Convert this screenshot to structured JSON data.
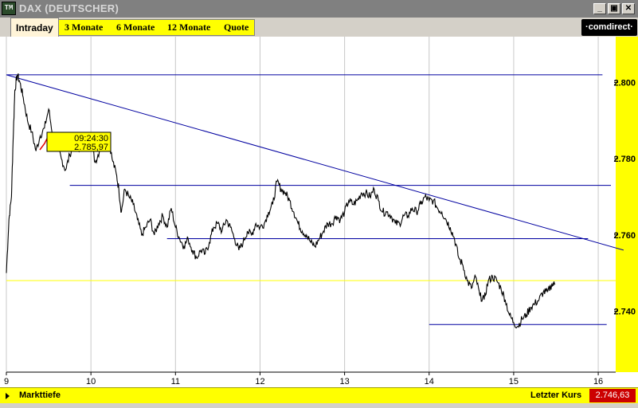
{
  "window": {
    "app_icon": "TM",
    "title": "DAX (DEUTSCHER)",
    "minimize_glyph": "_",
    "restore_glyph": "▣",
    "close_glyph": "✕"
  },
  "tabs": [
    {
      "label": "Intraday",
      "active": true
    },
    {
      "label": "3 Monate"
    },
    {
      "label": "6 Monate"
    },
    {
      "label": "12 Monate"
    },
    {
      "label": "Quote"
    }
  ],
  "brand": "·comdirect·",
  "tooltip": {
    "time": "09:24:30",
    "value": "2.785,97"
  },
  "bottom_bar": {
    "left_label": "Markttiefe",
    "last_price_label": "Letzter Kurs",
    "last_price": "2.746,63"
  },
  "colors": {
    "accent_yellow": "#ffff00",
    "trendline": "#0000a0",
    "price_line": "#000000",
    "last_price_bg": "#cc0000"
  },
  "chart_data": {
    "type": "line",
    "title": "",
    "xlabel": "",
    "ylabel": "",
    "x_ticks": [
      "9",
      "10",
      "11",
      "12",
      "13",
      "14",
      "15",
      "16"
    ],
    "y_ticks": [
      "2.800",
      "2.780",
      "2.760",
      "2.740"
    ],
    "xlim": [
      9.0,
      16.15
    ],
    "ylim": [
      2724,
      2812
    ],
    "grid": true,
    "series": [
      {
        "values": [
          [
            9.0,
            2750
          ],
          [
            9.03,
            2764
          ],
          [
            9.06,
            2770
          ],
          [
            9.08,
            2785
          ],
          [
            9.1,
            2798
          ],
          [
            9.13,
            2802
          ],
          [
            9.16,
            2800
          ],
          [
            9.2,
            2796
          ],
          [
            9.25,
            2790
          ],
          [
            9.3,
            2787
          ],
          [
            9.35,
            2782
          ],
          [
            9.4,
            2786
          ],
          [
            9.45,
            2788
          ],
          [
            9.5,
            2793
          ],
          [
            9.55,
            2786
          ],
          [
            9.6,
            2784
          ],
          [
            9.65,
            2780
          ],
          [
            9.7,
            2777
          ],
          [
            9.75,
            2781
          ],
          [
            9.8,
            2784
          ],
          [
            9.85,
            2782
          ],
          [
            9.9,
            2786
          ],
          [
            9.95,
            2783
          ],
          [
            10.0,
            2785
          ],
          [
            10.05,
            2779
          ],
          [
            10.1,
            2782
          ],
          [
            10.15,
            2784
          ],
          [
            10.2,
            2787
          ],
          [
            10.25,
            2780
          ],
          [
            10.3,
            2776
          ],
          [
            10.33,
            2772
          ],
          [
            10.36,
            2766
          ],
          [
            10.4,
            2772
          ],
          [
            10.45,
            2770
          ],
          [
            10.5,
            2768
          ],
          [
            10.55,
            2764
          ],
          [
            10.6,
            2760
          ],
          [
            10.65,
            2762
          ],
          [
            10.7,
            2764
          ],
          [
            10.75,
            2760
          ],
          [
            10.8,
            2763
          ],
          [
            10.85,
            2765
          ],
          [
            10.9,
            2762
          ],
          [
            10.95,
            2767
          ],
          [
            11.0,
            2762
          ],
          [
            11.05,
            2759
          ],
          [
            11.1,
            2757
          ],
          [
            11.15,
            2759
          ],
          [
            11.2,
            2756
          ],
          [
            11.25,
            2754
          ],
          [
            11.3,
            2756
          ],
          [
            11.35,
            2755
          ],
          [
            11.4,
            2758
          ],
          [
            11.45,
            2762
          ],
          [
            11.5,
            2763
          ],
          [
            11.55,
            2761
          ],
          [
            11.6,
            2764
          ],
          [
            11.65,
            2762
          ],
          [
            11.7,
            2759
          ],
          [
            11.75,
            2756
          ],
          [
            11.8,
            2758
          ],
          [
            11.85,
            2761
          ],
          [
            11.9,
            2760
          ],
          [
            11.95,
            2763
          ],
          [
            12.0,
            2762
          ],
          [
            12.05,
            2763
          ],
          [
            12.1,
            2766
          ],
          [
            12.15,
            2768
          ],
          [
            12.2,
            2774
          ],
          [
            12.25,
            2772
          ],
          [
            12.3,
            2771
          ],
          [
            12.35,
            2769
          ],
          [
            12.4,
            2766
          ],
          [
            12.45,
            2763
          ],
          [
            12.5,
            2761
          ],
          [
            12.55,
            2760
          ],
          [
            12.6,
            2758
          ],
          [
            12.65,
            2757
          ],
          [
            12.7,
            2759
          ],
          [
            12.75,
            2761
          ],
          [
            12.8,
            2763
          ],
          [
            12.85,
            2763
          ],
          [
            12.9,
            2765
          ],
          [
            12.95,
            2764
          ],
          [
            13.0,
            2766
          ],
          [
            13.05,
            2769
          ],
          [
            13.1,
            2768
          ],
          [
            13.15,
            2769
          ],
          [
            13.2,
            2771
          ],
          [
            13.25,
            2771
          ],
          [
            13.3,
            2770
          ],
          [
            13.35,
            2772
          ],
          [
            13.4,
            2769
          ],
          [
            13.45,
            2766
          ],
          [
            13.5,
            2766
          ],
          [
            13.55,
            2765
          ],
          [
            13.6,
            2763
          ],
          [
            13.65,
            2763
          ],
          [
            13.7,
            2765
          ],
          [
            13.75,
            2765
          ],
          [
            13.8,
            2767
          ],
          [
            13.85,
            2766
          ],
          [
            13.9,
            2768
          ],
          [
            13.95,
            2770
          ],
          [
            14.0,
            2769
          ],
          [
            14.05,
            2769
          ],
          [
            14.1,
            2767
          ],
          [
            14.15,
            2766
          ],
          [
            14.2,
            2764
          ],
          [
            14.25,
            2762
          ],
          [
            14.3,
            2759
          ],
          [
            14.35,
            2754
          ],
          [
            14.4,
            2752
          ],
          [
            14.45,
            2748
          ],
          [
            14.5,
            2746
          ],
          [
            14.55,
            2749
          ],
          [
            14.6,
            2744
          ],
          [
            14.65,
            2743
          ],
          [
            14.7,
            2748
          ],
          [
            14.75,
            2749
          ],
          [
            14.8,
            2748
          ],
          [
            14.85,
            2746
          ],
          [
            14.9,
            2743
          ],
          [
            14.95,
            2739
          ],
          [
            15.0,
            2737
          ],
          [
            15.05,
            2736
          ],
          [
            15.1,
            2738
          ],
          [
            15.15,
            2739
          ],
          [
            15.2,
            2741
          ],
          [
            15.25,
            2742
          ],
          [
            15.3,
            2743
          ],
          [
            15.35,
            2745
          ],
          [
            15.4,
            2745
          ],
          [
            15.45,
            2747
          ],
          [
            15.49,
            2747
          ]
        ]
      }
    ],
    "lines": [
      {
        "kind": "trend",
        "points": [
          [
            9.0,
            2802
          ],
          [
            16.3,
            2756
          ]
        ]
      },
      {
        "kind": "support",
        "y": 2802,
        "x": [
          9.0,
          16.05
        ]
      },
      {
        "kind": "support",
        "y": 2773,
        "x": [
          9.75,
          16.15
        ]
      },
      {
        "kind": "support",
        "y": 2759,
        "x": [
          10.9,
          15.88
        ]
      },
      {
        "kind": "support",
        "y": 2736.5,
        "x": [
          14.0,
          16.1
        ]
      },
      {
        "kind": "reference",
        "y": 2748,
        "color": "#ffff00"
      }
    ]
  }
}
